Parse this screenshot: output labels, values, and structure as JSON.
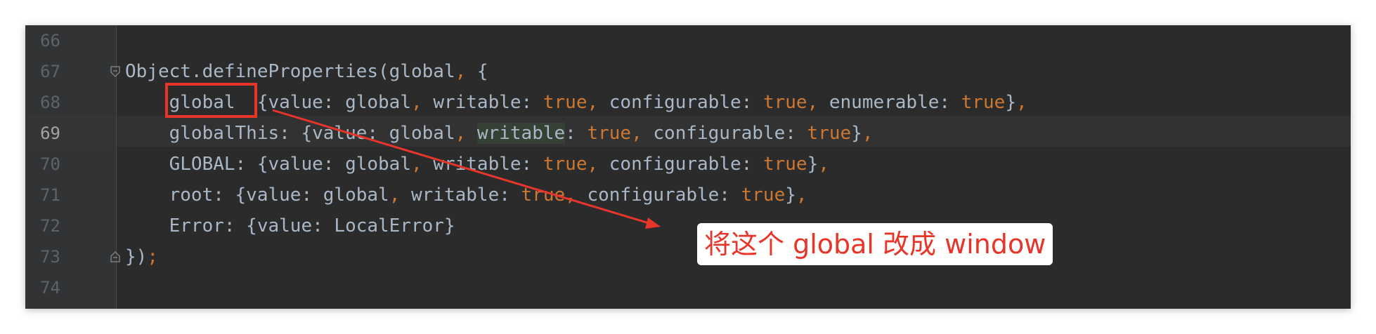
{
  "editor": {
    "lines": [
      {
        "num": "66",
        "segments": []
      },
      {
        "num": "67",
        "segments": [
          {
            "t": "Object.defineProperties(global",
            "c": "plain"
          },
          {
            "t": ", ",
            "c": "kw"
          },
          {
            "t": "{",
            "c": "plain"
          }
        ]
      },
      {
        "num": "68",
        "segments": [
          {
            "t": "    global  {value: global",
            "c": "plain"
          },
          {
            "t": ", ",
            "c": "kw"
          },
          {
            "t": "writable: ",
            "c": "plain"
          },
          {
            "t": "true, ",
            "c": "kw"
          },
          {
            "t": "configurable: ",
            "c": "plain"
          },
          {
            "t": "true, ",
            "c": "kw"
          },
          {
            "t": "enumerable: ",
            "c": "plain"
          },
          {
            "t": "true",
            "c": "kw"
          },
          {
            "t": "}",
            "c": "plain"
          },
          {
            "t": ",",
            "c": "kw"
          }
        ]
      },
      {
        "num": "69",
        "segments": [
          {
            "t": "    globalThis: {value: global",
            "c": "plain"
          },
          {
            "t": ", ",
            "c": "kw"
          },
          {
            "t": "writable",
            "c": "hl"
          },
          {
            "t": ": ",
            "c": "plain"
          },
          {
            "t": "true, ",
            "c": "kw"
          },
          {
            "t": "configurable: ",
            "c": "plain"
          },
          {
            "t": "true",
            "c": "kw"
          },
          {
            "t": "}",
            "c": "plain"
          },
          {
            "t": ",",
            "c": "kw"
          }
        ]
      },
      {
        "num": "70",
        "segments": [
          {
            "t": "    GLOBAL: {value: global",
            "c": "plain"
          },
          {
            "t": ", ",
            "c": "kw"
          },
          {
            "t": "writable: ",
            "c": "plain"
          },
          {
            "t": "true, ",
            "c": "kw"
          },
          {
            "t": "configurable: ",
            "c": "plain"
          },
          {
            "t": "true",
            "c": "kw"
          },
          {
            "t": "}",
            "c": "plain"
          },
          {
            "t": ",",
            "c": "kw"
          }
        ]
      },
      {
        "num": "71",
        "segments": [
          {
            "t": "    root: {value: global",
            "c": "plain"
          },
          {
            "t": ", ",
            "c": "kw"
          },
          {
            "t": "writable: ",
            "c": "plain"
          },
          {
            "t": "true, ",
            "c": "kw"
          },
          {
            "t": "configurable: ",
            "c": "plain"
          },
          {
            "t": "true",
            "c": "kw"
          },
          {
            "t": "}",
            "c": "plain"
          },
          {
            "t": ",",
            "c": "kw"
          }
        ]
      },
      {
        "num": "72",
        "segments": [
          {
            "t": "    Error: {value: LocalError}",
            "c": "plain"
          }
        ]
      },
      {
        "num": "73",
        "segments": [
          {
            "t": "})",
            "c": "plain"
          },
          {
            "t": ";",
            "c": "kw"
          }
        ]
      },
      {
        "num": "74",
        "segments": []
      }
    ],
    "active_line": "69"
  },
  "annotation": {
    "text": "将这个 global 改成 window"
  },
  "colors": {
    "background": "#2b2b2b",
    "plain": "#a9b7c6",
    "keyword": "#cc7832",
    "annotation_red": "#e8352a"
  }
}
